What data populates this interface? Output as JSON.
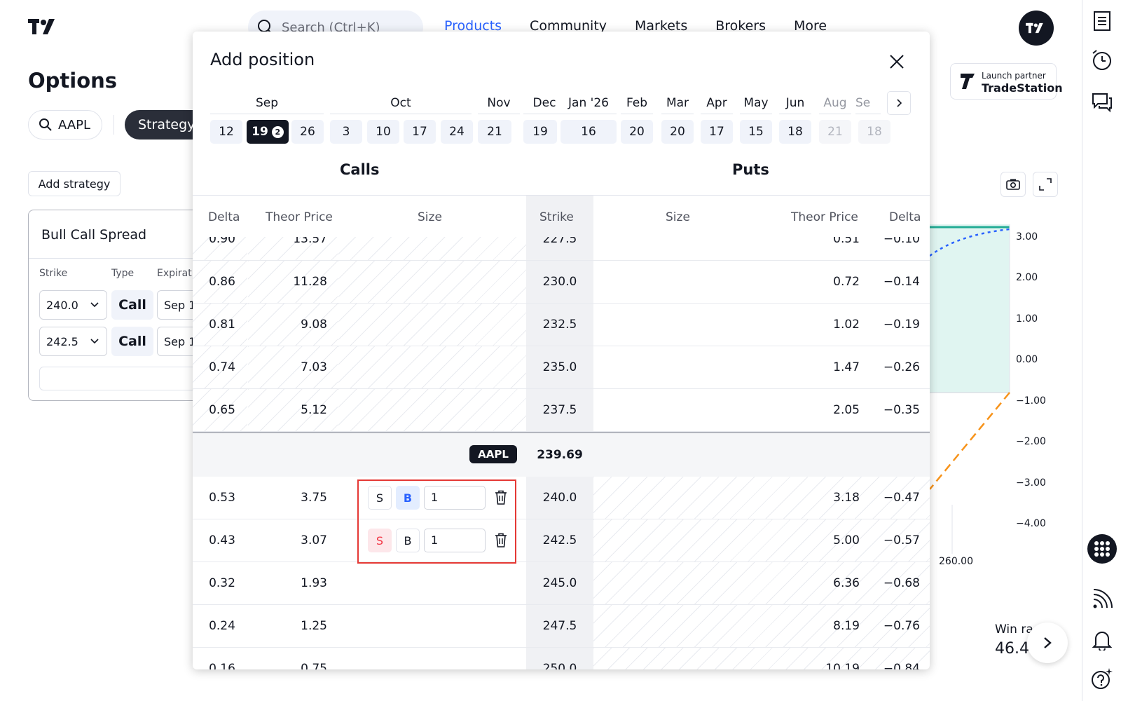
{
  "header": {
    "search_placeholder": "Search (Ctrl+K)",
    "nav": [
      {
        "label": "Products",
        "active": true
      },
      {
        "label": "Community",
        "active": false
      },
      {
        "label": "Markets",
        "active": false
      },
      {
        "label": "Brokers",
        "active": false
      },
      {
        "label": "More",
        "active": false
      }
    ]
  },
  "left_panel": {
    "title": "Options",
    "symbol": "AAPL",
    "strategy_tab": "Strategy",
    "add_strategy": "Add strategy",
    "strategy_card": {
      "title": "Bull Call Spread",
      "columns": [
        "Strike",
        "Type",
        "Expirati"
      ],
      "legs": [
        {
          "strike": "240.0",
          "type": "Call",
          "expiration": "Sep 1"
        },
        {
          "strike": "242.5",
          "type": "Call",
          "expiration": "Sep 1"
        }
      ]
    }
  },
  "right_panel": {
    "partner_kicker": "Launch partner",
    "partner_name": "TradeStation",
    "y_axis_labels": [
      "3.00",
      "2.00",
      "1.00",
      "0.00",
      "−1.00",
      "−2.00",
      "−3.00",
      "−4.00"
    ],
    "x_axis_label": "260.00",
    "win_rate_label": "Win ra",
    "win_rate_value": "46.4"
  },
  "modal": {
    "title": "Add position",
    "months": [
      {
        "label": "Sep",
        "dim": false
      },
      {
        "label": "Oct",
        "dim": false
      },
      {
        "label": "Nov",
        "dim": false
      },
      {
        "label": "Dec",
        "dim": false
      },
      {
        "label": "Jan '26",
        "dim": false
      },
      {
        "label": "Feb",
        "dim": false
      },
      {
        "label": "Mar",
        "dim": false
      },
      {
        "label": "Apr",
        "dim": false
      },
      {
        "label": "May",
        "dim": false
      },
      {
        "label": "Jun",
        "dim": false
      },
      {
        "label": "Aug",
        "dim": true
      },
      {
        "label": "Se",
        "dim": true
      }
    ],
    "dates": [
      {
        "label": "12",
        "selected": false,
        "dim": false
      },
      {
        "label": "19",
        "selected": true,
        "dim": false,
        "badge": "2"
      },
      {
        "label": "26",
        "selected": false,
        "dim": false
      },
      {
        "label": "3",
        "selected": false,
        "dim": false
      },
      {
        "label": "10",
        "selected": false,
        "dim": false
      },
      {
        "label": "17",
        "selected": false,
        "dim": false
      },
      {
        "label": "24",
        "selected": false,
        "dim": false
      },
      {
        "label": "21",
        "selected": false,
        "dim": false
      },
      {
        "label": "19",
        "selected": false,
        "dim": false
      },
      {
        "label": "16",
        "selected": false,
        "dim": false
      },
      {
        "label": "20",
        "selected": false,
        "dim": false
      },
      {
        "label": "20",
        "selected": false,
        "dim": false
      },
      {
        "label": "17",
        "selected": false,
        "dim": false
      },
      {
        "label": "15",
        "selected": false,
        "dim": false
      },
      {
        "label": "18",
        "selected": false,
        "dim": false
      },
      {
        "label": "21",
        "selected": false,
        "dim": true
      },
      {
        "label": "18",
        "selected": false,
        "dim": true
      }
    ],
    "calls_heading": "Calls",
    "puts_heading": "Puts",
    "columns": {
      "call_delta": "Delta",
      "call_theor": "Theor Price",
      "call_size": "Size",
      "strike": "Strike",
      "put_size": "Size",
      "put_theor": "Theor Price",
      "put_delta": "Delta"
    },
    "rows_above": [
      {
        "call_delta": "0.90",
        "call_theor": "13.57",
        "strike": "227.5",
        "put_theor": "0.51",
        "put_delta": "−0.10"
      },
      {
        "call_delta": "0.86",
        "call_theor": "11.28",
        "strike": "230.0",
        "put_theor": "0.72",
        "put_delta": "−0.14"
      },
      {
        "call_delta": "0.81",
        "call_theor": "9.08",
        "strike": "232.5",
        "put_theor": "1.02",
        "put_delta": "−0.19"
      },
      {
        "call_delta": "0.74",
        "call_theor": "7.03",
        "strike": "235.0",
        "put_theor": "1.47",
        "put_delta": "−0.26"
      },
      {
        "call_delta": "0.65",
        "call_theor": "5.12",
        "strike": "237.5",
        "put_theor": "2.05",
        "put_delta": "−0.35"
      }
    ],
    "underlying": {
      "ticker": "AAPL",
      "price": "239.69"
    },
    "rows_below": [
      {
        "call_delta": "0.53",
        "call_theor": "3.75",
        "strike": "240.0",
        "put_theor": "3.18",
        "put_delta": "−0.47",
        "sell": "S",
        "buy": "B",
        "qty": "1",
        "side": "buy"
      },
      {
        "call_delta": "0.43",
        "call_theor": "3.07",
        "strike": "242.5",
        "put_theor": "5.00",
        "put_delta": "−0.57",
        "sell": "S",
        "buy": "B",
        "qty": "1",
        "side": "sell"
      },
      {
        "call_delta": "0.32",
        "call_theor": "1.93",
        "strike": "245.0",
        "put_theor": "6.36",
        "put_delta": "−0.68"
      },
      {
        "call_delta": "0.24",
        "call_theor": "1.25",
        "strike": "247.5",
        "put_theor": "8.19",
        "put_delta": "−0.76"
      },
      {
        "call_delta": "0.16",
        "call_theor": "0.75",
        "strike": "250.0",
        "put_theor": "10.19",
        "put_delta": "−0.84"
      }
    ]
  },
  "colors": {
    "accent": "#2962ff",
    "sell": "#f23645",
    "highlight_border": "#e53935",
    "profit_fill": "#e0f5f1",
    "profit_line": "#22ab94",
    "expected_line": "#2962ff",
    "loss_line": "#f7931a"
  }
}
